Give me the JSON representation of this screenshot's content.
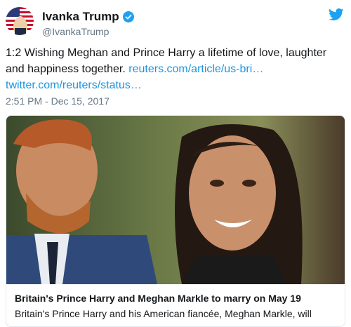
{
  "author": {
    "name": "Ivanka Trump",
    "handle": "@IvankaTrump",
    "avatar_icon": "avatar-flag-portrait",
    "verified_icon": "verified-badge-icon"
  },
  "brand_icon": "twitter-bird-icon",
  "tweet": {
    "text": "1:2 Wishing Meghan and Prince Harry a lifetime of love, laughter and happiness together.",
    "link1": "reuters.com/article/us-bri…",
    "link2": "twitter.com/reuters/status…",
    "timestamp": "2:51 PM - Dec 15, 2017"
  },
  "card": {
    "title": "Britain's Prince Harry and Meghan Markle to marry on May 19",
    "description": "Britain's Prince Harry and his American fiancée, Meghan Markle, will"
  },
  "colors": {
    "link": "#1b95e0",
    "muted": "#657786",
    "text": "#14171a",
    "verified": "#1da1f2"
  }
}
